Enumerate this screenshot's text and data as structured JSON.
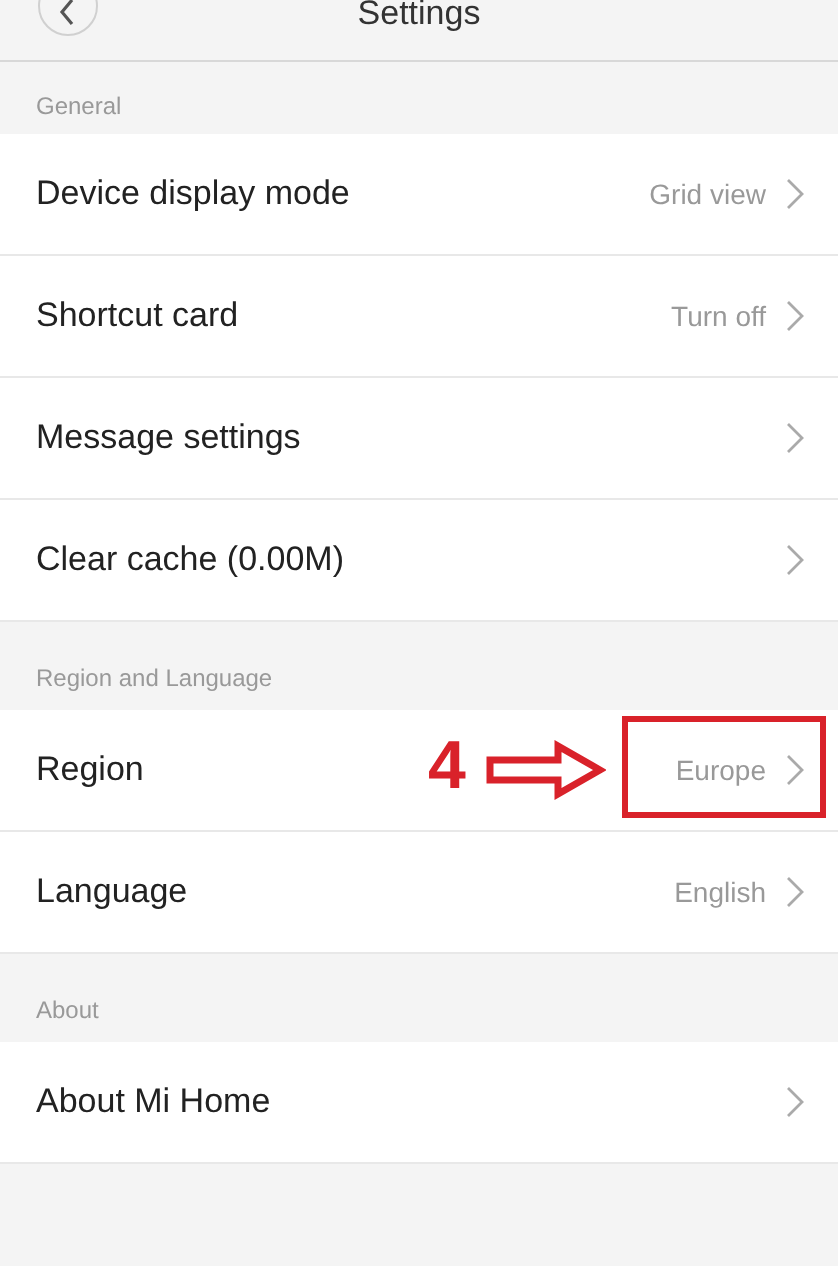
{
  "header": {
    "title": "Settings"
  },
  "sections": [
    {
      "title": "General",
      "rows": [
        {
          "label": "Device display mode",
          "value": "Grid view"
        },
        {
          "label": "Shortcut card",
          "value": "Turn off"
        },
        {
          "label": "Message settings"
        },
        {
          "label": "Clear cache (0.00M)"
        }
      ]
    },
    {
      "title": "Region and Language",
      "rows": [
        {
          "label": "Region",
          "value": "Europe",
          "annotation": "4"
        },
        {
          "label": "Language",
          "value": "English"
        }
      ]
    },
    {
      "title": "About",
      "rows": [
        {
          "label": "About Mi Home"
        }
      ]
    }
  ]
}
